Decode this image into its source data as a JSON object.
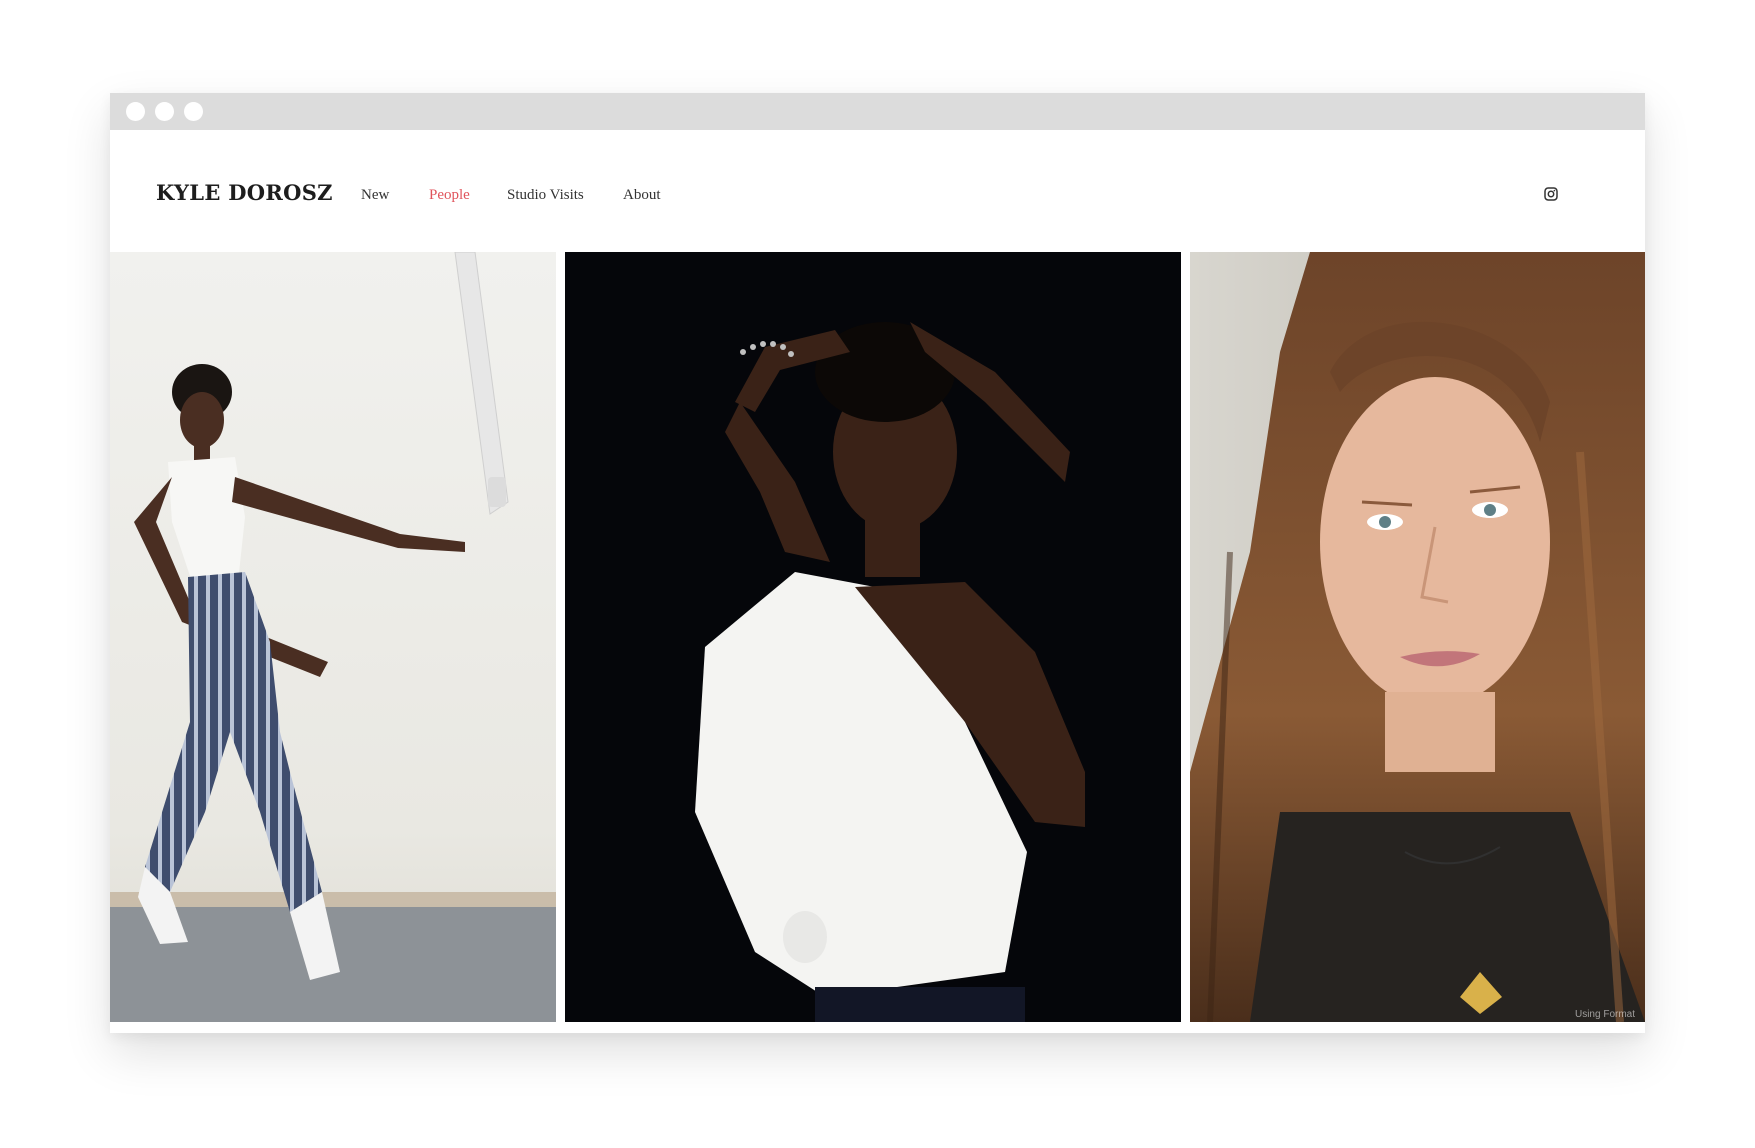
{
  "site": {
    "logo": "KYLE DOROSZ",
    "nav": [
      {
        "label": "New",
        "active": false
      },
      {
        "label": "People",
        "active": true
      },
      {
        "label": "Studio Visits",
        "active": false
      },
      {
        "label": "About",
        "active": false
      }
    ],
    "social_icon": "instagram-icon"
  },
  "colors": {
    "nav_default": "#333333",
    "nav_active": "#e0535b",
    "titlebar": "#dcdcdc"
  },
  "gallery": {
    "photos": [
      {
        "subject": "dancer-white-wall"
      },
      {
        "subject": "dancer-black-background"
      },
      {
        "subject": "portrait-long-hair"
      }
    ],
    "credit": "Using Format"
  }
}
